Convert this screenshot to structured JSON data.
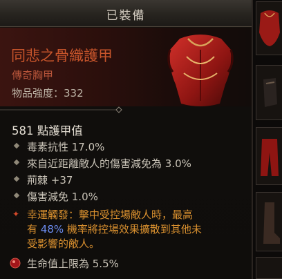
{
  "header": {
    "title": "已裝備"
  },
  "item": {
    "name": "同悲之骨織護甲",
    "type": "傳奇胸甲",
    "power": "物品強度：332",
    "armor": "581 點護甲值"
  },
  "stats": [
    "毒素抗性 17.0%",
    "來自近距離敵人的傷害減免為 3.0%",
    "荊棘 +37",
    "傷害減免 1.0%"
  ],
  "legendary_aspect": {
    "line1": "幸運觸發：擊中受控場敵人時，最高",
    "line2_before": "有 ",
    "line2_pct": "48%",
    "line2_after": " 機率將控場效果擴散到其他未",
    "line3": "受影響的敵人。"
  },
  "socket_stat": "生命值上限為 5.5%",
  "colors": {
    "legendary_name": "#c8552b",
    "legendary_aspect": "#d9902f",
    "value_highlight": "#6c8cf0",
    "stat_text": "#c9c3b7"
  },
  "icons": [
    "chest-armor-image",
    "diamond-bullet-icon",
    "star-icon",
    "ruby-gem-icon"
  ]
}
